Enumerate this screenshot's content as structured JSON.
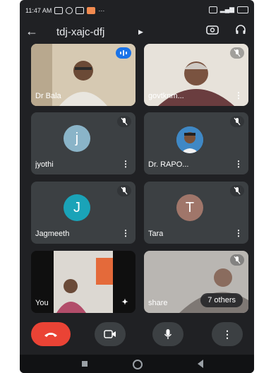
{
  "status_bar": {
    "time": "11:47 AM",
    "extra": "···"
  },
  "meeting": {
    "title": "tdj-xajc-dfj"
  },
  "tiles": {
    "dr_bala": {
      "name": "Dr Bala"
    },
    "govtknm": {
      "name": "govtknm..."
    },
    "jyothi": {
      "name": "jyothi",
      "initial": "j"
    },
    "dr_rapo": {
      "name": "Dr. RAPO..."
    },
    "jagmeeth": {
      "name": "Jagmeeth",
      "initial": "J"
    },
    "tara": {
      "name": "Tara",
      "initial": "T"
    },
    "you": {
      "name": "You"
    },
    "share": {
      "name": "share",
      "others": "7 others"
    }
  },
  "icons": [
    "back-arrow-icon",
    "camera-switch-icon",
    "headphones-icon",
    "mic-off-icon",
    "more-vert-icon",
    "end-call-icon",
    "video-icon",
    "mic-icon"
  ],
  "colors": {
    "background": "#202124",
    "tile": "#3c4043",
    "end_call": "#ea4335",
    "speaking": "#1a73e8",
    "avatar_jyothi": "#8ab4c8",
    "avatar_jagmeeth": "#1aa3b8",
    "avatar_tara": "#a0766a"
  }
}
